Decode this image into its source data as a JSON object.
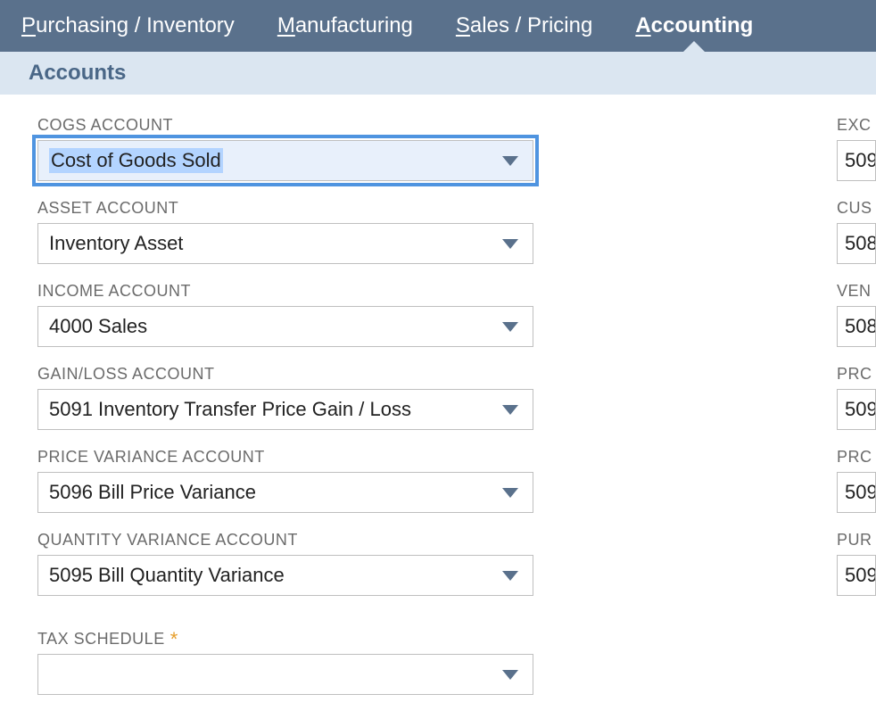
{
  "nav": {
    "purchasing": "urchasing / Inventory",
    "purchasing_mn": "P",
    "manufacturing": "anufacturing",
    "manufacturing_mn": "M",
    "sales": "ales / Pricing",
    "sales_mn": "S",
    "accounting": "ccounting",
    "accounting_mn": "A"
  },
  "subheader": "Accounts",
  "left": {
    "cogs": {
      "label": "COGS ACCOUNT",
      "value": "Cost of Goods Sold"
    },
    "asset": {
      "label": "ASSET ACCOUNT",
      "value": "Inventory Asset"
    },
    "income": {
      "label": "INCOME ACCOUNT",
      "value": "4000 Sales"
    },
    "gainloss": {
      "label": "GAIN/LOSS ACCOUNT",
      "value": "5091 Inventory Transfer Price Gain / Loss"
    },
    "pricevar": {
      "label": "PRICE VARIANCE ACCOUNT",
      "value": "5096 Bill Price Variance"
    },
    "qtyvar": {
      "label": "QUANTITY VARIANCE ACCOUNT",
      "value": "5095 Bill Quantity Variance"
    },
    "tax": {
      "label": "TAX SCHEDULE",
      "value": ""
    }
  },
  "right": {
    "exc": {
      "label": "EXC",
      "value": "509"
    },
    "cus": {
      "label": "CUS",
      "value": "508"
    },
    "ven": {
      "label": "VEN",
      "value": "508"
    },
    "prc1": {
      "label": "PRC",
      "value": "509"
    },
    "prc2": {
      "label": "PRC",
      "value": "509"
    },
    "pur": {
      "label": "PUR",
      "value": "509"
    }
  }
}
